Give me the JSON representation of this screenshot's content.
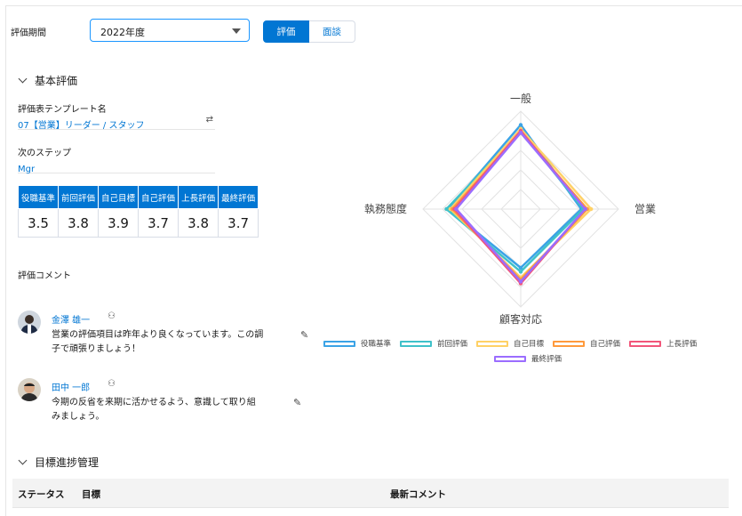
{
  "period": {
    "label": "評価期間",
    "value": "2022年度"
  },
  "toggle": {
    "active": "評価",
    "inactive": "面談"
  },
  "basic_section": {
    "title": "基本評価"
  },
  "template": {
    "label": "評価表テンプレート名",
    "value": "07【営業】リーダー / スタッフ"
  },
  "next_step": {
    "label": "次のステップ",
    "value": "Mgr"
  },
  "scores": {
    "headers": [
      "役職基準",
      "前回評価",
      "自己目標",
      "自己評価",
      "上長評価",
      "最終評価"
    ],
    "values": [
      "3.5",
      "3.8",
      "3.9",
      "3.7",
      "3.8",
      "3.7"
    ]
  },
  "comments": {
    "label": "評価コメント",
    "items": [
      {
        "author": "金澤 雄一",
        "text_line1": "営業の評価項目は昨年より良くなっています。この調",
        "text_line2": "子で頑張りましょう！"
      },
      {
        "author": "田中 一郎",
        "text_line1": "今期の反省を来期に活かせるよう、意識して取り組",
        "text_line2": "みましょう。"
      }
    ]
  },
  "goal_section": {
    "title": "目標進捗管理"
  },
  "goal_table": {
    "headers": [
      "ステータス",
      "目標",
      "最新コメント"
    ]
  },
  "colors": {
    "brand": "#0176d3",
    "series": [
      "#3ba3e6",
      "#3fc1c9",
      "#ffd166",
      "#ff9a3c",
      "#f2567a",
      "#9b6dff"
    ]
  },
  "chart_data": {
    "type": "radar",
    "axes": [
      "一般",
      "営業",
      "顧客対応",
      "執務態度"
    ],
    "range": [
      0,
      5
    ],
    "series": [
      {
        "name": "役職基準",
        "values": [
          4.3,
          3.1,
          3.0,
          3.7
        ]
      },
      {
        "name": "前回評価",
        "values": [
          4.0,
          3.2,
          3.2,
          3.8
        ]
      },
      {
        "name": "自己目標",
        "values": [
          4.1,
          3.6,
          3.5,
          3.6
        ]
      },
      {
        "name": "自己評価",
        "values": [
          3.9,
          3.4,
          3.6,
          3.5
        ]
      },
      {
        "name": "上長評価",
        "values": [
          4.0,
          3.3,
          3.8,
          3.4
        ]
      },
      {
        "name": "最終評価",
        "values": [
          3.9,
          3.3,
          3.7,
          3.3
        ]
      }
    ]
  }
}
